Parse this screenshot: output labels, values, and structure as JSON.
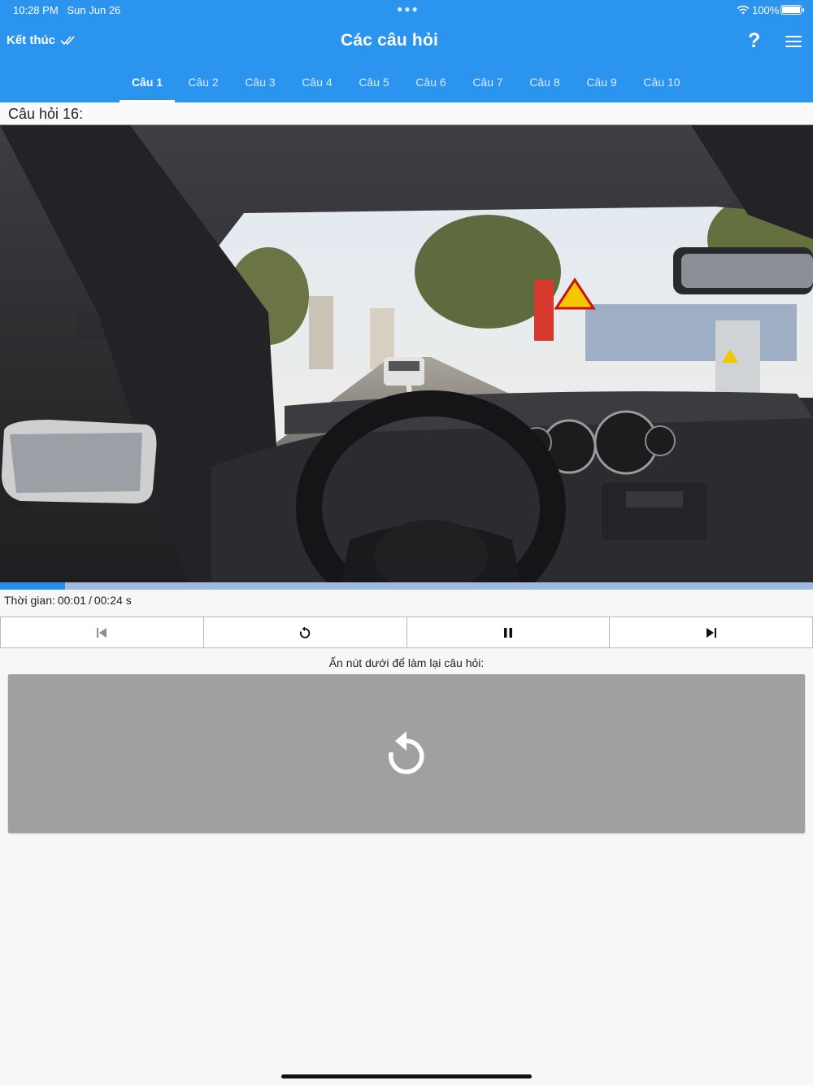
{
  "status_bar": {
    "time": "10:28 PM",
    "date": "Sun Jun 26",
    "battery_pct": "100%"
  },
  "header": {
    "finish_label": "Kết thúc",
    "title": "Các câu hỏi",
    "help_label": "?",
    "tabs": [
      {
        "label": "Câu 1",
        "active": true
      },
      {
        "label": "Câu 2"
      },
      {
        "label": "Câu 3"
      },
      {
        "label": "Câu 4"
      },
      {
        "label": "Câu 5"
      },
      {
        "label": "Câu 6"
      },
      {
        "label": "Câu 7"
      },
      {
        "label": "Câu 8"
      },
      {
        "label": "Câu 9"
      },
      {
        "label": "Câu 10"
      }
    ]
  },
  "question": {
    "label": "Câu hỏi 16:"
  },
  "player": {
    "progress_fraction": 0.08,
    "time_label": "Thời gian:",
    "current": "00:01",
    "separator": "/",
    "total": "00:24 s"
  },
  "controls": {
    "buttons": [
      "skip-back-icon",
      "replay-icon",
      "pause-icon",
      "skip-forward-icon"
    ]
  },
  "replay": {
    "prompt": "Ấn nút dưới để làm lại câu hỏi:",
    "icon": "replay-icon"
  },
  "colors": {
    "header_bg": "#2b94ee",
    "progress_fill": "#2b8cf0",
    "progress_track": "#9fbcdf",
    "replay_panel": "#a0a0a0"
  }
}
